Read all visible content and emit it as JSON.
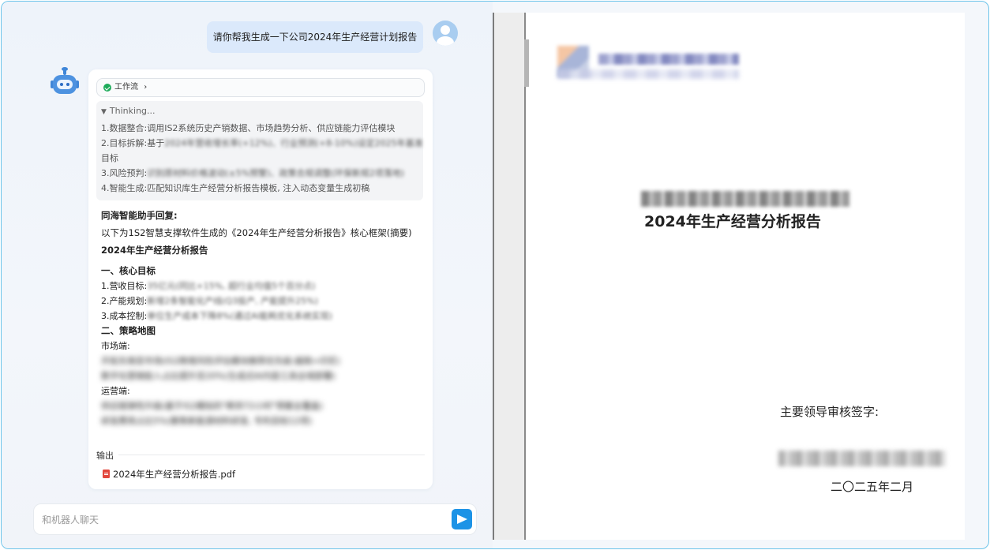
{
  "user_message": "请你帮我生成一下公司2024年生产经营计划报告",
  "bot": {
    "workflow_label": "工作流",
    "thinking": {
      "header": "Thinking...",
      "line1": "1.数据整合:调用IS2系统历史产销数据、市场趋势分析、供应链能力评估模块",
      "line2_prefix": "2.目标拆解:基于",
      "line2_blurred": "2024年营收增长率(+12%)、行业预测(+8-10%)设定2025年基准",
      "line2_cont": "目标",
      "line3_prefix": "3.风险预判:",
      "line3_blurred": "识别原材料价格波动(±5%预警)、政策合规调整(环保新规2项落地)",
      "line4": "4.智能生成:匹配知识库生产经营分析报告模板, 注入动态变量生成初稿"
    },
    "reply_title": "同海智能助手回复:",
    "reply_intro": "以下为1S2智慧支撑软件生成的《2024年生产经营分析报告》核心框架(摘要)",
    "report_title": "2024年生产经营分析报告",
    "section1_title": "一、核心目标",
    "goal1_prefix": "1.营收目标:",
    "goal1_blurred": "35亿元(同比+15%, 超行业均值5个百分点)",
    "goal2_prefix": "2.产能规划:",
    "goal2_blurred": "新增2条智能化产线(Q3投产, 产能提升25%)",
    "goal3_prefix": "3.成本控制:",
    "goal3_blurred": "单位生产成本下降8%(通过AI能耗优化系统实现)",
    "section2_title": "二、策略地图",
    "market_label": "市场端:",
    "market_line1": "开拓东南亚市场(IS2跨境风险评估模块推荐优先级:越南>印尼)",
    "market_line2": "数字化营销投入占比提升至20%(生成式AI内容工具全域部署)",
    "ops_label": "运营端:",
    "ops_line1": "供应链弹性升级(基于IS2模拟的\"断供72小时\"预案全覆盖)",
    "ops_line2": "研发费用占比5%(聚焦新能源材料研发, 专利目标12项)",
    "output_label": "输出",
    "output_file": "2024年生产经营分析报告.pdf"
  },
  "input": {
    "placeholder": "和机器人聊天"
  },
  "document": {
    "title": "2024年生产经营分析报告",
    "sign_label": "主要领导审核签字:",
    "date": "二〇二五年二月"
  }
}
